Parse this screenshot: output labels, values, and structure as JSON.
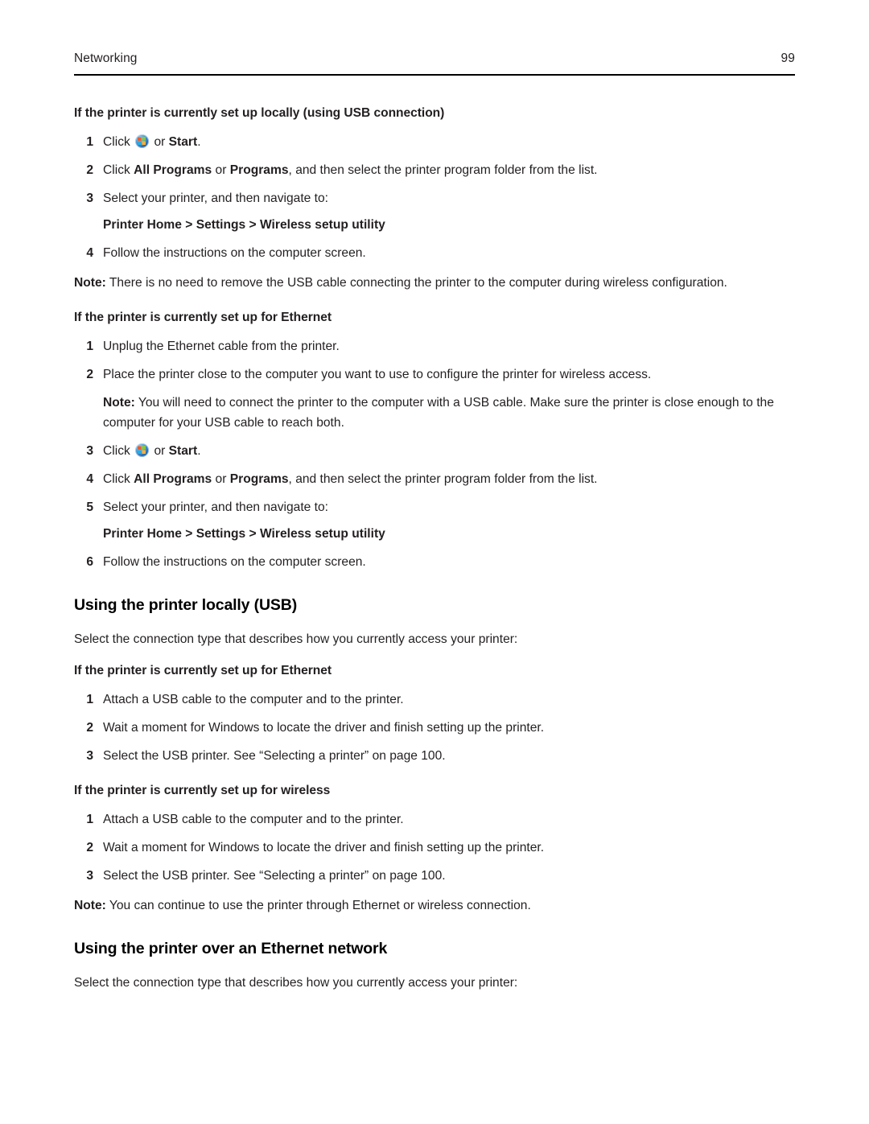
{
  "header": {
    "title": "Networking",
    "page_number": "99"
  },
  "sections": [
    {
      "heading": "If the printer is currently set up locally (using USB connection)",
      "steps": [
        {
          "num": "1",
          "prefix": "Click ",
          "icon": "windows-start-orb-icon",
          "middle": " or ",
          "bold": "Start",
          "suffix": "."
        },
        {
          "num": "2",
          "prefix": "Click ",
          "bold": "All Programs",
          "middle": " or ",
          "bold2": "Programs",
          "suffix": ", and then select the printer program folder from the list."
        },
        {
          "num": "3",
          "text": "Select your printer, and then navigate to:"
        },
        {
          "num": "4",
          "text": "Follow the instructions on the computer screen."
        }
      ],
      "path": "Printer Home > Settings > Wireless setup utility",
      "note_label": "Note:",
      "note_text": " There is no need to remove the USB cable connecting the printer to the computer during wireless configuration."
    },
    {
      "heading": "If the printer is currently set up for Ethernet",
      "steps": [
        {
          "num": "1",
          "text": "Unplug the Ethernet cable from the printer."
        },
        {
          "num": "2",
          "text": "Place the printer close to the computer you want to use to configure the printer for wireless access."
        },
        {
          "num": "3",
          "prefix": "Click ",
          "icon": "windows-start-orb-icon",
          "middle": " or ",
          "bold": "Start",
          "suffix": "."
        },
        {
          "num": "4",
          "prefix": "Click ",
          "bold": "All Programs",
          "middle": " or ",
          "bold2": "Programs",
          "suffix": ", and then select the printer program folder from the list."
        },
        {
          "num": "5",
          "text": "Select your printer, and then navigate to:"
        },
        {
          "num": "6",
          "text": "Follow the instructions on the computer screen."
        }
      ],
      "path": "Printer Home > Settings > Wireless setup utility",
      "note_label": "Note:",
      "note_text": " You will need to connect the printer to the computer with a USB cable. Make sure the printer is close enough to the computer for your USB cable to reach both."
    }
  ],
  "usb_section": {
    "heading": "Using the printer locally (USB)",
    "intro": "Select the connection type that describes how you currently access your printer:",
    "ethernet_sub": {
      "heading": "If the printer is currently set up for Ethernet",
      "steps": [
        {
          "num": "1",
          "text": "Attach a USB cable to the computer and to the printer."
        },
        {
          "num": "2",
          "text": "Wait a moment for Windows to locate the driver and finish setting up the printer."
        },
        {
          "num": "3",
          "text": "Select the USB printer. See “Selecting a printer” on page 100."
        }
      ]
    },
    "wireless_sub": {
      "heading": "If the printer is currently set up for wireless",
      "steps": [
        {
          "num": "1",
          "text": "Attach a USB cable to the computer and to the printer."
        },
        {
          "num": "2",
          "text": "Wait a moment for Windows to locate the driver and finish setting up the printer."
        },
        {
          "num": "3",
          "text": "Select the USB printer. See “Selecting a printer” on page 100."
        }
      ]
    },
    "note_label": "Note:",
    "note_text": " You can continue to use the printer through Ethernet or wireless connection."
  },
  "ethernet_section": {
    "heading": "Using the printer over an Ethernet network",
    "intro": "Select the connection type that describes how you currently access your printer:"
  }
}
